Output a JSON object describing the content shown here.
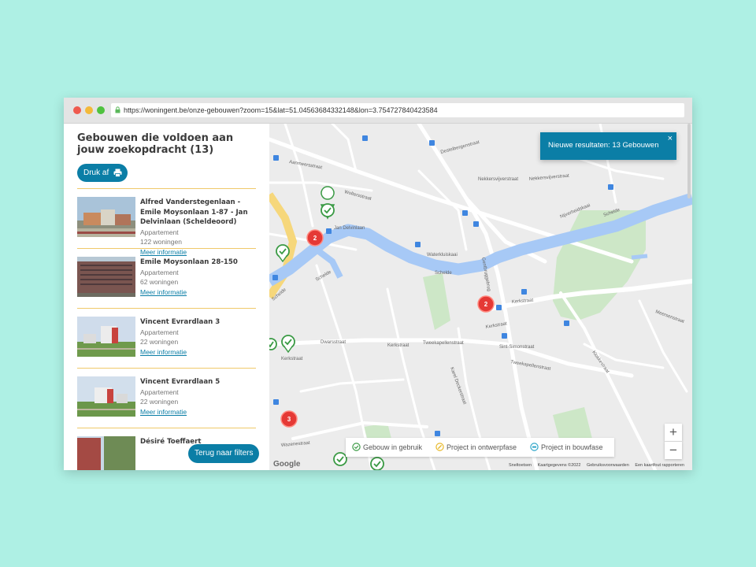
{
  "browser": {
    "url": "https://woningent.be/onze-gebouwen?zoom=15&lat=51.04563684332148&lon=3.754727840423584"
  },
  "sidebar": {
    "heading": "Gebouwen die voldoen aan jouw zoekopdracht (13)",
    "print_label": "Druk af",
    "back_label": "Terug naar filters",
    "items": [
      {
        "title": "Alfred Vanderstegenlaan - Emile Moysonlaan 1-87 - Jan Delvinlaan (Scheldeoord)",
        "type": "Appartement",
        "units": "122 woningen",
        "link": "Meer informatie"
      },
      {
        "title": "Emile Moysonlaan 28-150",
        "type": "Appartement",
        "units": "62 woningen",
        "link": "Meer informatie"
      },
      {
        "title": "Vincent Evrardlaan 3",
        "type": "Appartement",
        "units": "22 woningen",
        "link": "Meer informatie"
      },
      {
        "title": "Vincent Evrardlaan 5",
        "type": "Appartement",
        "units": "22 woningen",
        "link": "Meer informatie"
      },
      {
        "title": "Désiré Toeffaert",
        "type": "",
        "units": "",
        "link": ""
      }
    ]
  },
  "map": {
    "toast": "Nieuwe resultaten: 13 Gebouwen",
    "toast_close": "×",
    "legend": {
      "in_use": "Gebouw in gebruik",
      "design": "Project in ontwerpfase",
      "construction": "Project in bouwfase"
    },
    "zoom_in": "+",
    "zoom_out": "−",
    "google": "Google",
    "attribution": {
      "shortcuts": "Sneltoetsen",
      "mapdata": "Kaartgegevens ©2022",
      "terms": "Gebruiksvoorwaarden",
      "report": "Een kaartfout rapporteren"
    },
    "clusters": [
      "2",
      "2",
      "3"
    ],
    "streets": {
      "delvin": "Jan Delvinlaan",
      "schelde1": "Schelde",
      "schelde2": "Schelde",
      "schelde3": "Schelde",
      "schelde4": "Schelde",
      "kerk1": "Kerkstraat",
      "kerk2": "Kerkstraat",
      "kerk3": "Kerkstraat",
      "tweekap1": "Tweekapellenstraat",
      "tweekap2": "Tweekapellenstraat",
      "nekkers1": "Nekkersvijverstraat",
      "nekkers2": "Nekkersvijverstraat",
      "nijverheid": "Nijverheidskaai",
      "waterkluis": "Waterkluiskaai",
      "destelbergen": "Destelbergenstraat",
      "aanmeers": "Aanmeersstraat",
      "wolters": "Woltersstraat",
      "dwars": "Dwarsstraat",
      "sintsimon": "Sint-Simonstraat",
      "kerkstraat_short": "Kerkstraat",
      "meersen": "Meersenstraat",
      "wazens": "Wazenestraat",
      "klokke": "Klokkestraat",
      "gentbrugge": "Gentbruggebrug",
      "karel": "Karel Deckerstraat"
    }
  }
}
